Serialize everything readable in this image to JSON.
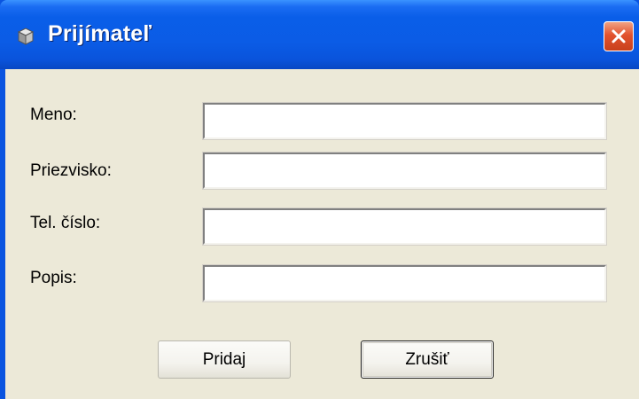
{
  "window": {
    "title": "Prijímateľ",
    "icons": {
      "app": "app-icon",
      "close": "close-icon"
    }
  },
  "form": {
    "fields": [
      {
        "label": "Meno:",
        "value": ""
      },
      {
        "label": "Priezvisko:",
        "value": ""
      },
      {
        "label": "Tel. číslo:",
        "value": ""
      },
      {
        "label": "Popis:",
        "value": ""
      }
    ]
  },
  "buttons": {
    "add_label": "Pridaj",
    "cancel_label": "Zrušiť"
  },
  "colors": {
    "titlebar": "#0a5ee8",
    "client_bg": "#ece9d8",
    "close_red": "#e2532e"
  }
}
